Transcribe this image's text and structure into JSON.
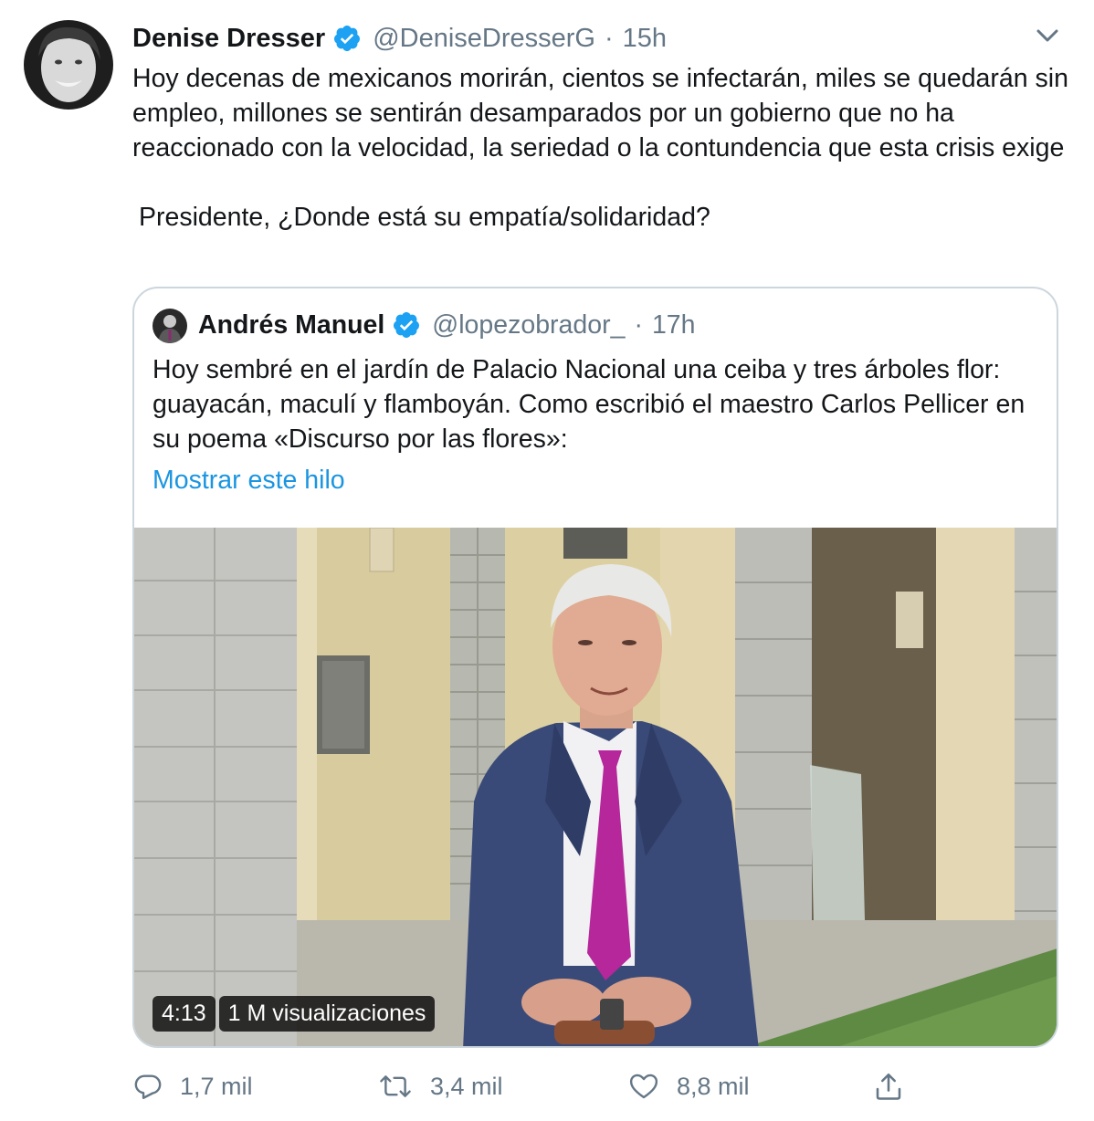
{
  "colors": {
    "accent": "#1b95e0",
    "text": "#14171a",
    "secondary": "#657786",
    "border": "#ccd6dd",
    "verified": "#1da1f2",
    "tie": "#b5279a",
    "suit": "#3a4a78"
  },
  "tweet": {
    "author": {
      "name": "Denise Dresser",
      "handle": "@DeniseDresserG",
      "separator": "·",
      "time": "15h",
      "verified": true
    },
    "text_para1": "Hoy decenas de mexicanos morirán, cientos se infectarán, miles se quedarán sin empleo, millones se sentirán desamparados por un gobierno que no ha reaccionado con la velocidad, la seriedad o la contundencia que esta crisis exige",
    "text_para2": "Presidente, ¿Donde está su empatía/solidaridad?",
    "quote": {
      "author": {
        "name": "Andrés Manuel",
        "handle": "@lopezobrador_",
        "separator": "·",
        "time": "17h",
        "verified": true
      },
      "text": "Hoy sembré en el jardín de Palacio Nacional una ceiba y tres árboles flor: guayacán, maculí y flamboyán. Como escribió el maestro Carlos Pellicer en su poema «Discurso por las flores»:",
      "show_thread": "Mostrar este hilo",
      "video": {
        "duration": "4:13",
        "views": "1 M visualizaciones"
      }
    },
    "actions": {
      "replies": "1,7 mil",
      "retweets": "3,4 mil",
      "likes": "8,8 mil"
    },
    "icons": [
      "verified-icon",
      "caret-down-icon",
      "reply-icon",
      "retweet-icon",
      "like-icon",
      "share-icon"
    ]
  }
}
